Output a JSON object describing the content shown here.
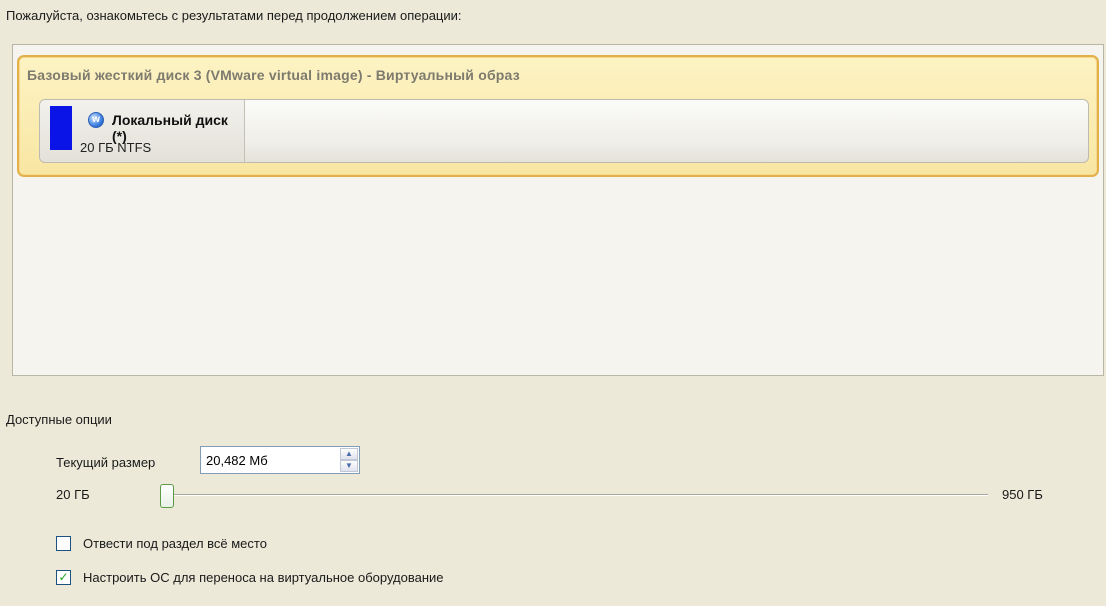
{
  "instruction": "Пожалуйста, ознакомьтесь с результатами перед продолжением операции:",
  "disk": {
    "title": "Базовый жесткий диск 3 (VMware virtual image) - Виртуальный образ",
    "partition": {
      "name": "Локальный диск (*)",
      "info": "20 ГБ NTFS",
      "color": "#0a14e6",
      "icon": "windows-os-icon"
    }
  },
  "options": {
    "label": "Доступные опции",
    "current_size_label": "Текущий размер",
    "current_size_value": "20,482 Мб",
    "slider": {
      "min_label": "20 ГБ",
      "max_label": "950 ГБ",
      "value_fraction": 0.0
    },
    "checkboxes": [
      {
        "label": "Отвести под раздел всё место",
        "checked": false
      },
      {
        "label": "Настроить ОС для переноса на виртуальное оборудование",
        "checked": true
      }
    ]
  }
}
